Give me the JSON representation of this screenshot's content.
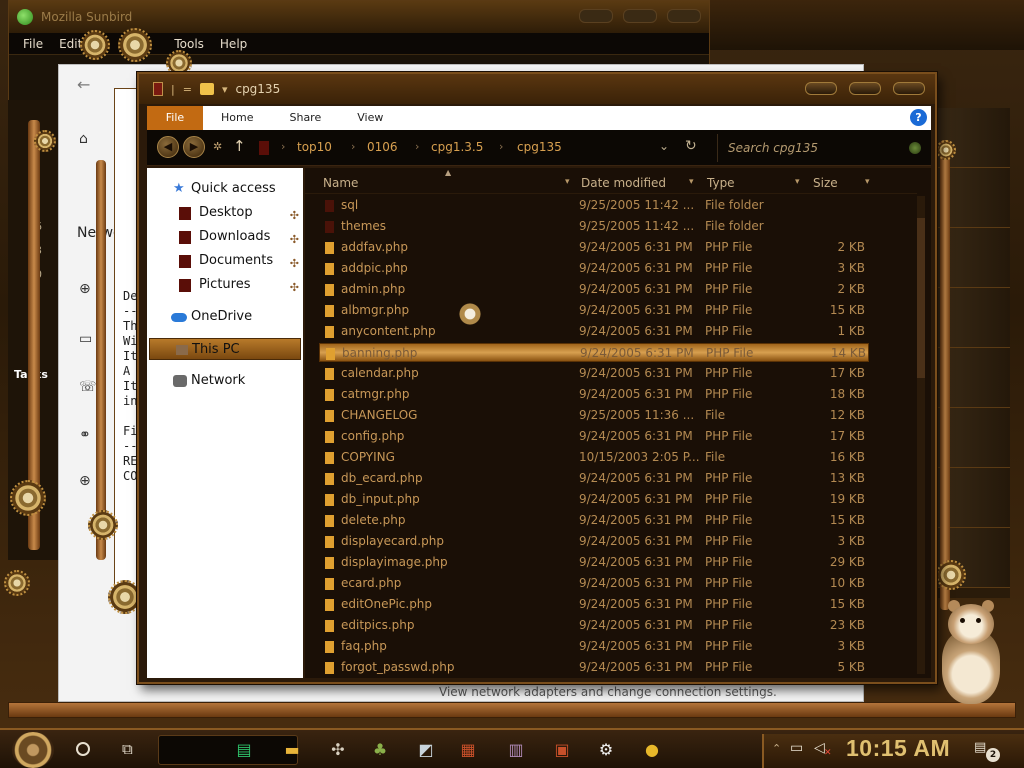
{
  "background_windows": {
    "browser": {
      "title": "Mozilla Sunbird",
      "menu": [
        "File",
        "Edit",
        "Tools",
        "Help"
      ]
    },
    "settings": {
      "side_label": "Netwo",
      "caption": "View network adapters and change connection settings."
    },
    "notepad_fragment": {
      "lines": [
        "De",
        "--",
        "Th",
        "Wi",
        "It",
        "A",
        "It",
        "in",
        "",
        "Fi",
        "--",
        "RE",
        "CO"
      ]
    },
    "calendar_fragment": {
      "numbers": [
        "2",
        "9",
        "16",
        "23",
        "30"
      ],
      "label": "Tasks"
    }
  },
  "explorer": {
    "title": "cpg135",
    "ribbon_tabs": [
      {
        "label": "File",
        "active": true
      },
      {
        "label": "Home",
        "active": false
      },
      {
        "label": "Share",
        "active": false
      },
      {
        "label": "View",
        "active": false
      }
    ],
    "help_label": "?",
    "breadcrumb": [
      "top10",
      "0106",
      "cpg1.3.5",
      "cpg135"
    ],
    "search_placeholder": "Search cpg135",
    "nav_pane": [
      {
        "label": "Quick access",
        "icon": "star-icon",
        "pinned": false,
        "selected": false
      },
      {
        "label": "Desktop",
        "icon": "desktop-folder-icon",
        "pinned": true,
        "selected": false
      },
      {
        "label": "Downloads",
        "icon": "downloads-folder-icon",
        "pinned": true,
        "selected": false
      },
      {
        "label": "Documents",
        "icon": "documents-folder-icon",
        "pinned": true,
        "selected": false
      },
      {
        "label": "Pictures",
        "icon": "pictures-folder-icon",
        "pinned": true,
        "selected": false
      },
      {
        "label": "OneDrive",
        "icon": "cloud-icon",
        "pinned": false,
        "selected": false
      },
      {
        "label": "This PC",
        "icon": "computer-icon",
        "pinned": false,
        "selected": true
      },
      {
        "label": "Network",
        "icon": "network-icon",
        "pinned": false,
        "selected": false
      }
    ],
    "columns": [
      "Name",
      "Date modified",
      "Type",
      "Size"
    ],
    "files": [
      {
        "name": "sql",
        "date": "9/25/2005 11:42 ...",
        "type": "File folder",
        "size": "",
        "kind": "folder",
        "selected": false
      },
      {
        "name": "themes",
        "date": "9/25/2005 11:42 ...",
        "type": "File folder",
        "size": "",
        "kind": "folder",
        "selected": false
      },
      {
        "name": "addfav.php",
        "date": "9/24/2005 6:31 PM",
        "type": "PHP File",
        "size": "2 KB",
        "kind": "file",
        "selected": false
      },
      {
        "name": "addpic.php",
        "date": "9/24/2005 6:31 PM",
        "type": "PHP File",
        "size": "3 KB",
        "kind": "file",
        "selected": false
      },
      {
        "name": "admin.php",
        "date": "9/24/2005 6:31 PM",
        "type": "PHP File",
        "size": "2 KB",
        "kind": "file",
        "selected": false
      },
      {
        "name": "albmgr.php",
        "date": "9/24/2005 6:31 PM",
        "type": "PHP File",
        "size": "15 KB",
        "kind": "file",
        "selected": false
      },
      {
        "name": "anycontent.php",
        "date": "9/24/2005 6:31 PM",
        "type": "PHP File",
        "size": "1 KB",
        "kind": "file",
        "selected": false
      },
      {
        "name": "banning.php",
        "date": "9/24/2005 6:31 PM",
        "type": "PHP File",
        "size": "14 KB",
        "kind": "file",
        "selected": true
      },
      {
        "name": "calendar.php",
        "date": "9/24/2005 6:31 PM",
        "type": "PHP File",
        "size": "17 KB",
        "kind": "file",
        "selected": false
      },
      {
        "name": "catmgr.php",
        "date": "9/24/2005 6:31 PM",
        "type": "PHP File",
        "size": "18 KB",
        "kind": "file",
        "selected": false
      },
      {
        "name": "CHANGELOG",
        "date": "9/25/2005 11:36 ...",
        "type": "File",
        "size": "12 KB",
        "kind": "file",
        "selected": false
      },
      {
        "name": "config.php",
        "date": "9/24/2005 6:31 PM",
        "type": "PHP File",
        "size": "17 KB",
        "kind": "file",
        "selected": false
      },
      {
        "name": "COPYING",
        "date": "10/15/2003 2:05 P...",
        "type": "File",
        "size": "16 KB",
        "kind": "file",
        "selected": false
      },
      {
        "name": "db_ecard.php",
        "date": "9/24/2005 6:31 PM",
        "type": "PHP File",
        "size": "13 KB",
        "kind": "file",
        "selected": false
      },
      {
        "name": "db_input.php",
        "date": "9/24/2005 6:31 PM",
        "type": "PHP File",
        "size": "19 KB",
        "kind": "file",
        "selected": false
      },
      {
        "name": "delete.php",
        "date": "9/24/2005 6:31 PM",
        "type": "PHP File",
        "size": "15 KB",
        "kind": "file",
        "selected": false
      },
      {
        "name": "displayecard.php",
        "date": "9/24/2005 6:31 PM",
        "type": "PHP File",
        "size": "3 KB",
        "kind": "file",
        "selected": false
      },
      {
        "name": "displayimage.php",
        "date": "9/24/2005 6:31 PM",
        "type": "PHP File",
        "size": "29 KB",
        "kind": "file",
        "selected": false
      },
      {
        "name": "ecard.php",
        "date": "9/24/2005 6:31 PM",
        "type": "PHP File",
        "size": "10 KB",
        "kind": "file",
        "selected": false
      },
      {
        "name": "editOnePic.php",
        "date": "9/24/2005 6:31 PM",
        "type": "PHP File",
        "size": "15 KB",
        "kind": "file",
        "selected": false
      },
      {
        "name": "editpics.php",
        "date": "9/24/2005 6:31 PM",
        "type": "PHP File",
        "size": "23 KB",
        "kind": "file",
        "selected": false
      },
      {
        "name": "faq.php",
        "date": "9/24/2005 6:31 PM",
        "type": "PHP File",
        "size": "3 KB",
        "kind": "file",
        "selected": false
      },
      {
        "name": "forgot_passwd.php",
        "date": "9/24/2005 6:31 PM",
        "type": "PHP File",
        "size": "5 KB",
        "kind": "file",
        "selected": false
      }
    ]
  },
  "taskbar": {
    "apps": [
      {
        "name": "notes-app-icon",
        "glyph": "▤",
        "color": "#2ec26a"
      },
      {
        "name": "file-explorer-icon",
        "glyph": "▬",
        "color": "#e8b43a"
      },
      {
        "name": "windmill-app-icon",
        "glyph": "✣",
        "color": "#d8d0c0"
      },
      {
        "name": "tree-app-icon",
        "glyph": "♣",
        "color": "#8ab04a"
      },
      {
        "name": "slides-app-icon",
        "glyph": "◩",
        "color": "#c8d4dc"
      },
      {
        "name": "book-app-icon",
        "glyph": "▦",
        "color": "#c8502a"
      },
      {
        "name": "panel-app-icon",
        "glyph": "▥",
        "color": "#b08ab8"
      },
      {
        "name": "calendar-app-icon",
        "glyph": "▣",
        "color": "#c8502a"
      },
      {
        "name": "settings-gear-icon",
        "glyph": "⚙",
        "color": "#f0f0f0"
      },
      {
        "name": "bee-app-icon",
        "glyph": "●",
        "color": "#e8b82a"
      }
    ],
    "time": "10:15 AM",
    "notification_count": "2"
  }
}
